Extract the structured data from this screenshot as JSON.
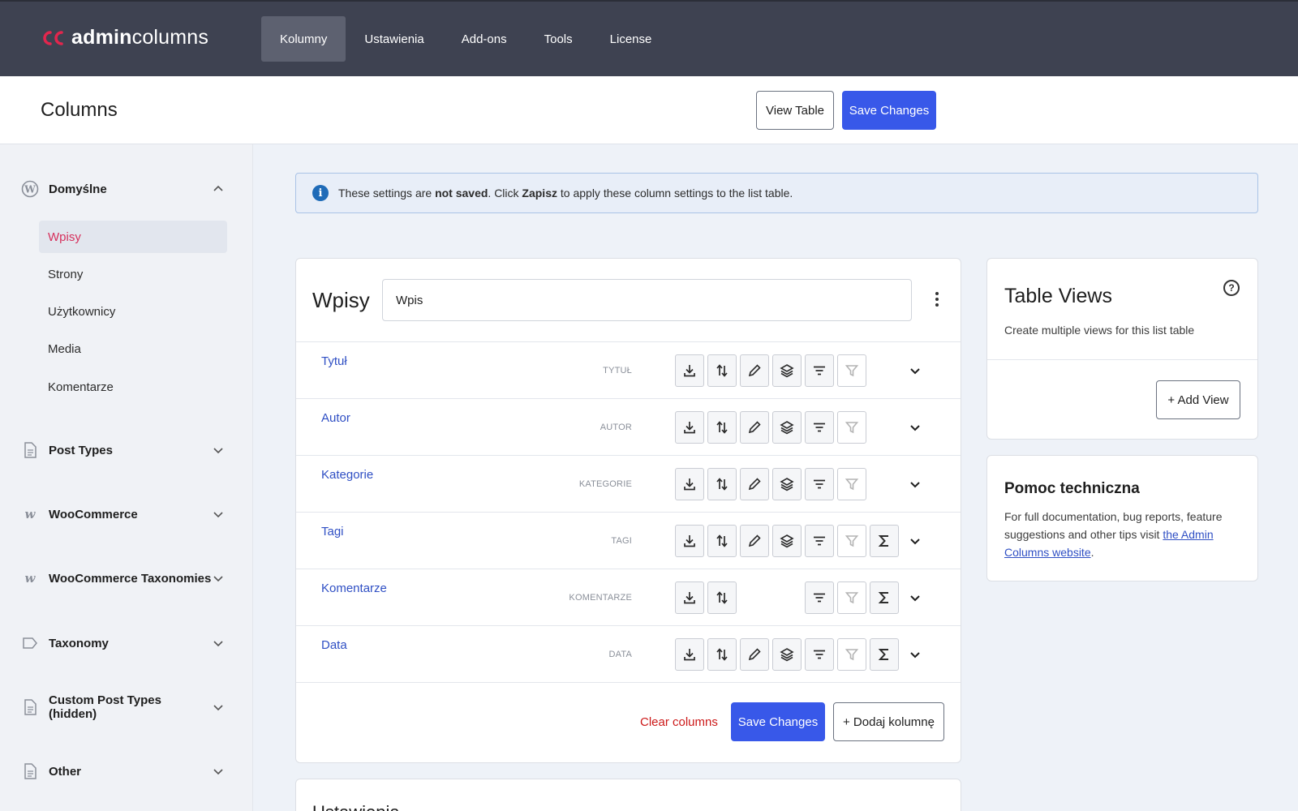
{
  "brand": {
    "prefix": "admin",
    "suffix": "columns"
  },
  "nav": [
    {
      "label": "Kolumny",
      "active": true
    },
    {
      "label": "Ustawienia",
      "active": false
    },
    {
      "label": "Add-ons",
      "active": false
    },
    {
      "label": "Tools",
      "active": false
    },
    {
      "label": "License",
      "active": false
    }
  ],
  "header": {
    "title": "Columns",
    "view_table": "View Table",
    "save": "Save Changes"
  },
  "sidebar": {
    "default_group": "Domyślne",
    "items": [
      "Wpisy",
      "Strony",
      "Użytkownicy",
      "Media",
      "Komentarze"
    ],
    "groups": [
      "Post Types",
      "WooCommerce",
      "WooCommerce Taxonomies",
      "Taxonomy",
      "Custom Post Types (hidden)",
      "Other"
    ]
  },
  "notice": {
    "pre": "These settings are ",
    "bold1": "not saved",
    "mid": ". Click ",
    "bold2": "Zapisz",
    "post": " to apply these column settings to the list table."
  },
  "main": {
    "title": "Wpisy",
    "name_value": "Wpis",
    "columns": [
      {
        "label": "Tytuł",
        "type": "TYTUŁ"
      },
      {
        "label": "Autor",
        "type": "AUTOR"
      },
      {
        "label": "Kategorie",
        "type": "KATEGORIE"
      },
      {
        "label": "Tagi",
        "type": "TAGI"
      },
      {
        "label": "Komentarze",
        "type": "KOMENTARZE"
      },
      {
        "label": "Data",
        "type": "DATA"
      }
    ],
    "clear": "Clear columns",
    "save": "Save Changes",
    "add_column": "+ Dodaj kolumnę"
  },
  "peek": {
    "title": "Ustawienia"
  },
  "table_views": {
    "title": "Table Views",
    "help": "?",
    "description": "Create multiple views for this list table",
    "add_view": "+ Add View"
  },
  "support": {
    "title": "Pomoc techniczna",
    "text": "For full documentation, bug reports, feature suggestions and other tips visit ",
    "link": "the Admin Columns website",
    "end": "."
  },
  "colors": {
    "accent": "#3858e9",
    "topbar": "#3e4251",
    "active_link": "#d6305c",
    "danger": "#cc1818"
  }
}
